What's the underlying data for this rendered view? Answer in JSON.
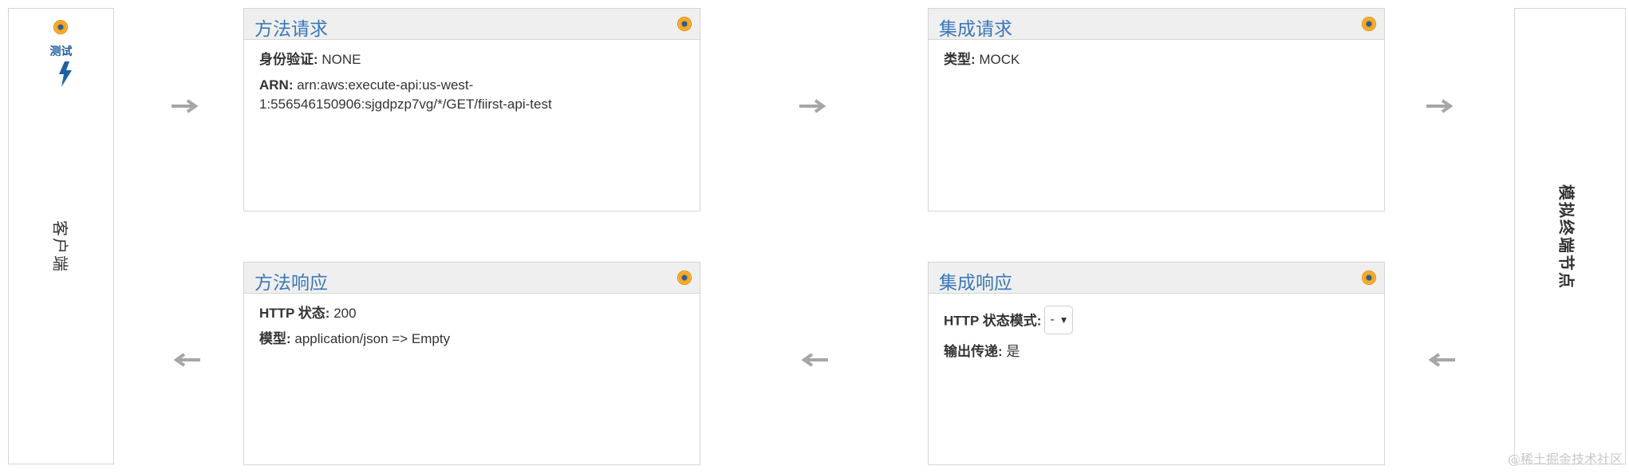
{
  "client": {
    "test_label": "测试",
    "label": "客户端"
  },
  "endpoint": {
    "label": "模拟终端节点"
  },
  "method_request": {
    "title": "方法请求",
    "auth_label": "身份验证:",
    "auth_value": " NONE",
    "arn_label": "ARN:",
    "arn_value": " arn:aws:execute-api:us-west-1:556546150906:sjgdpzp7vg/*/GET/fiirst-api-test"
  },
  "integration_request": {
    "title": "集成请求",
    "type_label": "类型:",
    "type_value": " MOCK"
  },
  "method_response": {
    "title": "方法响应",
    "status_label": "HTTP 状态:",
    "status_value": " 200",
    "model_label": "模型:",
    "model_value": " application/json => Empty"
  },
  "integration_response": {
    "title": "集成响应",
    "pattern_label": "HTTP 状态模式:",
    "pattern_value": "-",
    "passthrough_label": "输出传递:",
    "passthrough_value": " 是"
  },
  "watermark": "@稀土掘金技术社区",
  "icons": {
    "settings": "gear-icon",
    "test": "lightning-icon",
    "arrow_right": "arrow-right-icon",
    "arrow_left": "arrow-left-icon"
  },
  "colors": {
    "accent": "#3b78b9",
    "header_bg": "#efefef",
    "border": "#d5d5d5",
    "arrow": "#a6a6a6"
  }
}
